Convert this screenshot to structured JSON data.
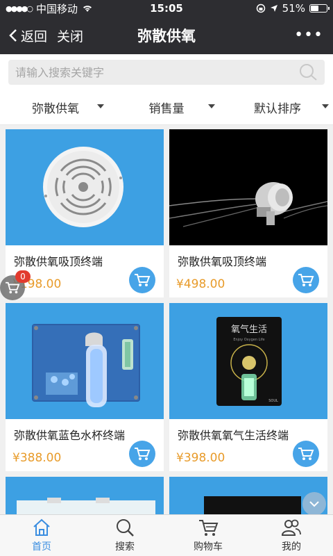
{
  "status": {
    "carrier": "中国移动",
    "time": "15:05",
    "battery": "51%",
    "battery_level": 0.51
  },
  "nav": {
    "back_label": "返回",
    "close_label": "关闭",
    "title": "弥散供氧",
    "more_label": "•••"
  },
  "search": {
    "placeholder": "请输入搜索关键字"
  },
  "filters": [
    {
      "label": "弥散供氧"
    },
    {
      "label": "销售量"
    },
    {
      "label": "默认排序"
    }
  ],
  "products": [
    {
      "name": "弥散供氧吸顶终端",
      "price": "¥198.00",
      "image": "round-ceiling-diffuser"
    },
    {
      "name": "弥散供氧吸顶终端",
      "price": "¥498.00",
      "image": "ceiling-light-terminal"
    },
    {
      "name": "弥散供氧蓝色水杯终端",
      "price": "¥388.00",
      "image": "blue-cup-terminal"
    },
    {
      "name": "弥散供氧氧气生活终端",
      "price": "¥398.00",
      "image": "oxygen-life-terminal"
    }
  ],
  "product_images": {
    "oxygen_life_title": "氧气生活",
    "oxygen_life_sub": "Enjoy Oxygen Life",
    "oxygen_life_brand": "SOUL"
  },
  "float_cart": {
    "count": "0"
  },
  "tabs": [
    {
      "label": "首页",
      "icon": "home-icon"
    },
    {
      "label": "搜索",
      "icon": "search-icon"
    },
    {
      "label": "购物车",
      "icon": "cart-icon"
    },
    {
      "label": "我的",
      "icon": "user-icon"
    }
  ],
  "colors": {
    "header_bg": "#2d2d31",
    "product_bg": "#3da0e3",
    "price": "#e89b2a",
    "cart_button": "#47a4e8",
    "tab_active": "#3a8de0",
    "badge": "#e23b2e"
  }
}
